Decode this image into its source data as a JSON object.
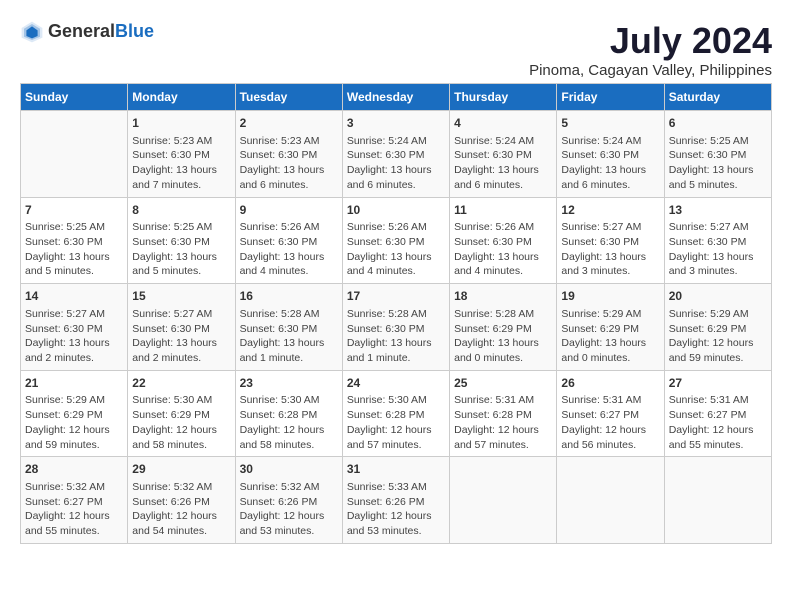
{
  "header": {
    "logo_general": "General",
    "logo_blue": "Blue",
    "title": "July 2024",
    "subtitle": "Pinoma, Cagayan Valley, Philippines"
  },
  "calendar": {
    "days_of_week": [
      "Sunday",
      "Monday",
      "Tuesday",
      "Wednesday",
      "Thursday",
      "Friday",
      "Saturday"
    ],
    "weeks": [
      [
        {
          "day": "",
          "info": ""
        },
        {
          "day": "1",
          "info": "Sunrise: 5:23 AM\nSunset: 6:30 PM\nDaylight: 13 hours\nand 7 minutes."
        },
        {
          "day": "2",
          "info": "Sunrise: 5:23 AM\nSunset: 6:30 PM\nDaylight: 13 hours\nand 6 minutes."
        },
        {
          "day": "3",
          "info": "Sunrise: 5:24 AM\nSunset: 6:30 PM\nDaylight: 13 hours\nand 6 minutes."
        },
        {
          "day": "4",
          "info": "Sunrise: 5:24 AM\nSunset: 6:30 PM\nDaylight: 13 hours\nand 6 minutes."
        },
        {
          "day": "5",
          "info": "Sunrise: 5:24 AM\nSunset: 6:30 PM\nDaylight: 13 hours\nand 6 minutes."
        },
        {
          "day": "6",
          "info": "Sunrise: 5:25 AM\nSunset: 6:30 PM\nDaylight: 13 hours\nand 5 minutes."
        }
      ],
      [
        {
          "day": "7",
          "info": "Sunrise: 5:25 AM\nSunset: 6:30 PM\nDaylight: 13 hours\nand 5 minutes."
        },
        {
          "day": "8",
          "info": "Sunrise: 5:25 AM\nSunset: 6:30 PM\nDaylight: 13 hours\nand 5 minutes."
        },
        {
          "day": "9",
          "info": "Sunrise: 5:26 AM\nSunset: 6:30 PM\nDaylight: 13 hours\nand 4 minutes."
        },
        {
          "day": "10",
          "info": "Sunrise: 5:26 AM\nSunset: 6:30 PM\nDaylight: 13 hours\nand 4 minutes."
        },
        {
          "day": "11",
          "info": "Sunrise: 5:26 AM\nSunset: 6:30 PM\nDaylight: 13 hours\nand 4 minutes."
        },
        {
          "day": "12",
          "info": "Sunrise: 5:27 AM\nSunset: 6:30 PM\nDaylight: 13 hours\nand 3 minutes."
        },
        {
          "day": "13",
          "info": "Sunrise: 5:27 AM\nSunset: 6:30 PM\nDaylight: 13 hours\nand 3 minutes."
        }
      ],
      [
        {
          "day": "14",
          "info": "Sunrise: 5:27 AM\nSunset: 6:30 PM\nDaylight: 13 hours\nand 2 minutes."
        },
        {
          "day": "15",
          "info": "Sunrise: 5:27 AM\nSunset: 6:30 PM\nDaylight: 13 hours\nand 2 minutes."
        },
        {
          "day": "16",
          "info": "Sunrise: 5:28 AM\nSunset: 6:30 PM\nDaylight: 13 hours\nand 1 minute."
        },
        {
          "day": "17",
          "info": "Sunrise: 5:28 AM\nSunset: 6:30 PM\nDaylight: 13 hours\nand 1 minute."
        },
        {
          "day": "18",
          "info": "Sunrise: 5:28 AM\nSunset: 6:29 PM\nDaylight: 13 hours\nand 0 minutes."
        },
        {
          "day": "19",
          "info": "Sunrise: 5:29 AM\nSunset: 6:29 PM\nDaylight: 13 hours\nand 0 minutes."
        },
        {
          "day": "20",
          "info": "Sunrise: 5:29 AM\nSunset: 6:29 PM\nDaylight: 12 hours\nand 59 minutes."
        }
      ],
      [
        {
          "day": "21",
          "info": "Sunrise: 5:29 AM\nSunset: 6:29 PM\nDaylight: 12 hours\nand 59 minutes."
        },
        {
          "day": "22",
          "info": "Sunrise: 5:30 AM\nSunset: 6:29 PM\nDaylight: 12 hours\nand 58 minutes."
        },
        {
          "day": "23",
          "info": "Sunrise: 5:30 AM\nSunset: 6:28 PM\nDaylight: 12 hours\nand 58 minutes."
        },
        {
          "day": "24",
          "info": "Sunrise: 5:30 AM\nSunset: 6:28 PM\nDaylight: 12 hours\nand 57 minutes."
        },
        {
          "day": "25",
          "info": "Sunrise: 5:31 AM\nSunset: 6:28 PM\nDaylight: 12 hours\nand 57 minutes."
        },
        {
          "day": "26",
          "info": "Sunrise: 5:31 AM\nSunset: 6:27 PM\nDaylight: 12 hours\nand 56 minutes."
        },
        {
          "day": "27",
          "info": "Sunrise: 5:31 AM\nSunset: 6:27 PM\nDaylight: 12 hours\nand 55 minutes."
        }
      ],
      [
        {
          "day": "28",
          "info": "Sunrise: 5:32 AM\nSunset: 6:27 PM\nDaylight: 12 hours\nand 55 minutes."
        },
        {
          "day": "29",
          "info": "Sunrise: 5:32 AM\nSunset: 6:26 PM\nDaylight: 12 hours\nand 54 minutes."
        },
        {
          "day": "30",
          "info": "Sunrise: 5:32 AM\nSunset: 6:26 PM\nDaylight: 12 hours\nand 53 minutes."
        },
        {
          "day": "31",
          "info": "Sunrise: 5:33 AM\nSunset: 6:26 PM\nDaylight: 12 hours\nand 53 minutes."
        },
        {
          "day": "",
          "info": ""
        },
        {
          "day": "",
          "info": ""
        },
        {
          "day": "",
          "info": ""
        }
      ]
    ]
  }
}
